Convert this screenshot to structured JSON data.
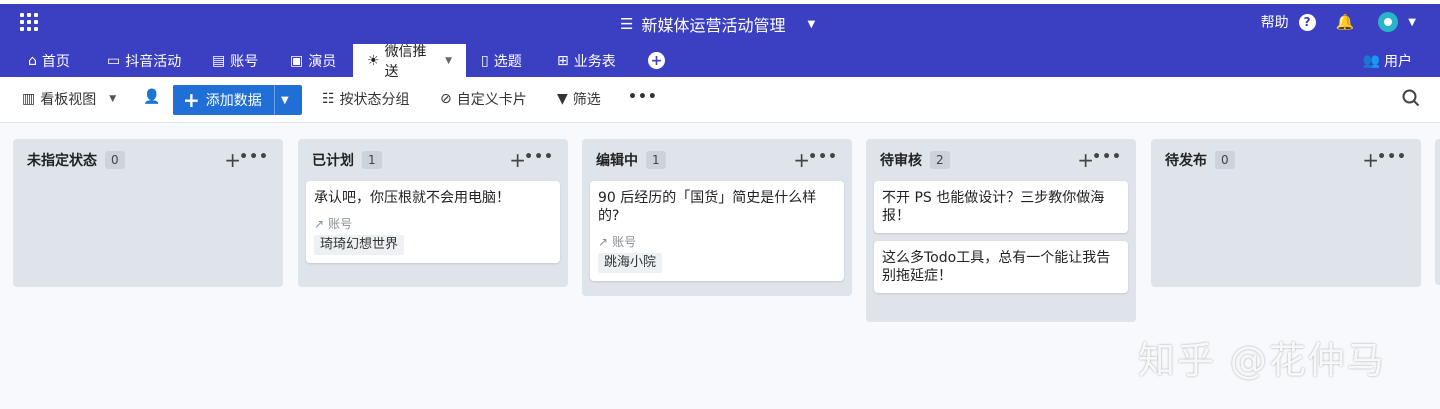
{
  "topbar": {
    "app_title": "新媒体运营活动管理",
    "help_label": "帮助",
    "help_icon": "?",
    "colors": {
      "primary": "#3b3fc2",
      "avatar": "#27b6c9"
    }
  },
  "tabs": [
    {
      "label": "首页",
      "icon": "home-icon"
    },
    {
      "label": "抖音活动",
      "icon": "laptop-icon"
    },
    {
      "label": "账号",
      "icon": "form-icon"
    },
    {
      "label": "演员",
      "icon": "contact-card-icon"
    },
    {
      "label": "微信推送",
      "icon": "lightbulb-icon",
      "active": true
    },
    {
      "label": "选题",
      "icon": "clipboard-icon"
    },
    {
      "label": "业务表",
      "icon": "table-icon"
    }
  ],
  "users_label": "用户",
  "toolbar": {
    "view_label": "看板视图",
    "add_label": "添加数据",
    "group_label": "按状态分组",
    "custom_card_label": "自定义卡片",
    "filter_label": "筛选",
    "accent": "#1f6fd6"
  },
  "columns": [
    {
      "title": "未指定状态",
      "count": "0",
      "cards": []
    },
    {
      "title": "已计划",
      "count": "1",
      "cards": [
        {
          "title": "承认吧，你压根就不会用电脑！",
          "field_label": "账号",
          "tag": "琦琦幻想世界"
        }
      ]
    },
    {
      "title": "编辑中",
      "count": "1",
      "cards": [
        {
          "title": "90 后经历的「国货」简史是什么样的?",
          "field_label": "账号",
          "tag": "跳海小院"
        }
      ]
    },
    {
      "title": "待审核",
      "count": "2",
      "cards": [
        {
          "title": "不开 PS 也能做设计？三步教你做海报！"
        },
        {
          "title": "这么多Todo工具，总有一个能让我告别拖延症！"
        }
      ]
    },
    {
      "title": "待发布",
      "count": "0",
      "cards": []
    }
  ],
  "watermark": "知乎 @花仲马"
}
